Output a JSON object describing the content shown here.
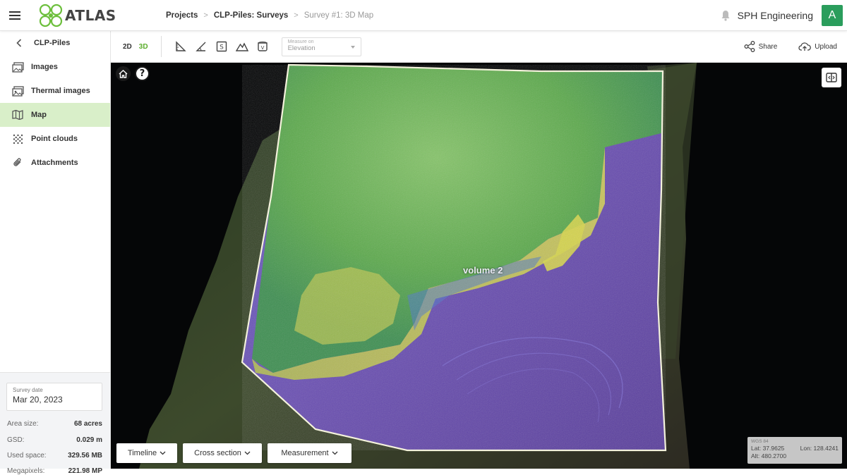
{
  "header": {
    "logo_text": "ATLAS",
    "breadcrumbs": [
      {
        "label": "Projects"
      },
      {
        "label": "CLP-Piles: Surveys"
      },
      {
        "label": "Survey #1: 3D Map"
      }
    ],
    "org_name": "SPH Engineering",
    "avatar_initial": "A"
  },
  "sidebar": {
    "back_label": "CLP-Piles",
    "items": [
      {
        "label": "Images",
        "icon": "images-icon"
      },
      {
        "label": "Thermal images",
        "icon": "thermal-images-icon"
      },
      {
        "label": "Map",
        "icon": "map-icon",
        "active": true
      },
      {
        "label": "Point clouds",
        "icon": "point-clouds-icon"
      },
      {
        "label": "Attachments",
        "icon": "attachments-icon"
      }
    ],
    "survey_date_label": "Survey date",
    "survey_date": "Mar 20, 2023",
    "stats": [
      {
        "label": "Area size:",
        "value": "68 acres"
      },
      {
        "label": "GSD:",
        "value": "0.029 m"
      },
      {
        "label": "Used space:",
        "value": "329.56 MB"
      },
      {
        "label": "Megapixels:",
        "value": "221.98 MP"
      }
    ]
  },
  "toolbar": {
    "view_2d": "2D",
    "view_3d": "3D",
    "active_view": "3D",
    "tools": [
      "ruler-icon",
      "angle-icon",
      "area-icon",
      "peak-icon",
      "volume-icon"
    ],
    "measure_on_label": "Measure on",
    "measure_on_value": "Elevation",
    "share_label": "Share",
    "upload_label": "Upload"
  },
  "map": {
    "volume_label": "volume 2",
    "bottom_buttons": [
      "Timeline",
      "Cross section",
      "Measurement"
    ],
    "coords": {
      "system": "WGS 84",
      "lat_label": "Lat:",
      "lat": "37.9625",
      "lon_label": "Lon:",
      "lon": "128.4241",
      "alt_label": "Alt:",
      "alt": "480.2700"
    }
  },
  "colors": {
    "accent": "#5aad2a",
    "active_nav_bg": "#d9efc9",
    "avatar_bg": "#2a9d5c"
  }
}
